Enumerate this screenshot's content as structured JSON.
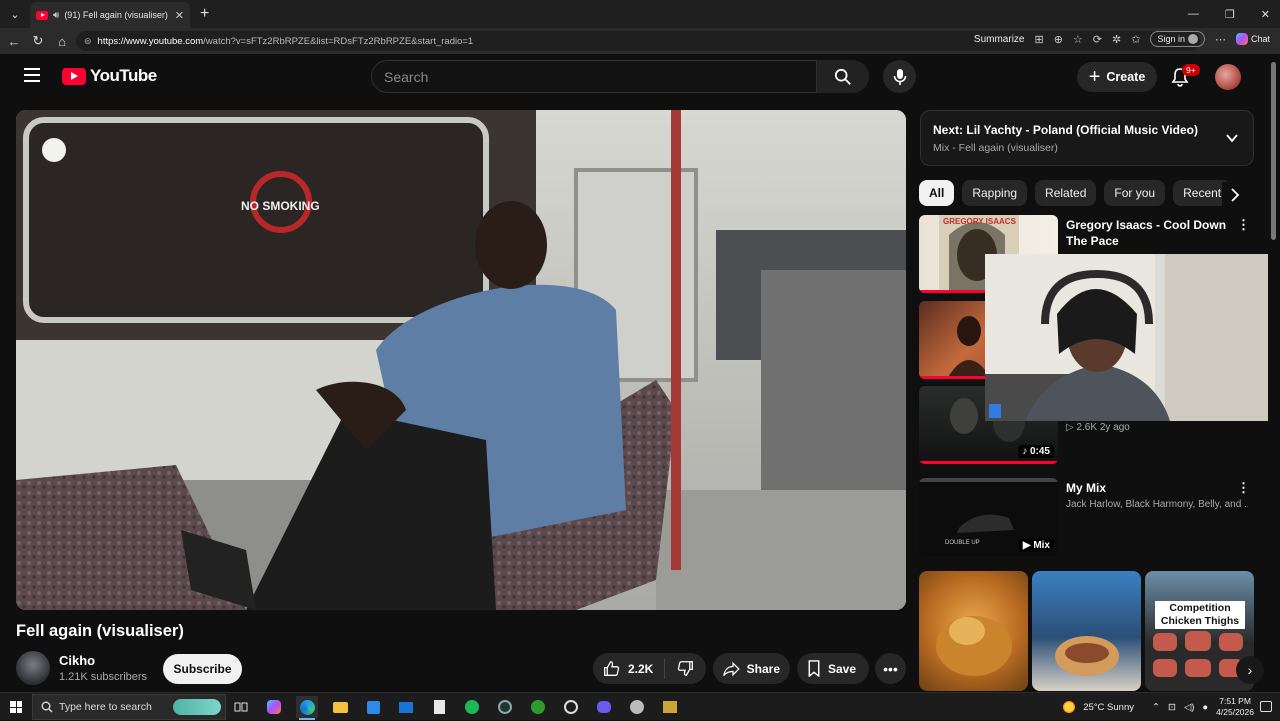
{
  "browser": {
    "tab_title": "(91) Fell again (visualiser) - Yo",
    "tab_close": "✕",
    "new_tab": "+",
    "url_host": "https://www.youtube.com",
    "url_path": "/watch?v=sFTz2RbRPZE&list=RDsFTz2RbRPZE&start_radio=1",
    "summarize": "Summarize",
    "sign_in": "Sign in",
    "chat": "Chat"
  },
  "header": {
    "logo_text": "YouTube",
    "search_placeholder": "Search",
    "create_label": "Create",
    "notification_count": "9+"
  },
  "video": {
    "overlay_sign": "NO SMOKING",
    "title": "Fell again (visualiser)",
    "channel_name": "Cikho",
    "subscribers": "1.21K subscribers",
    "subscribe_label": "Subscribe",
    "likes": "2.2K",
    "share_label": "Share",
    "save_label": "Save"
  },
  "up_next": {
    "prefix": "Next:",
    "title": "Lil Yachty - Poland (Official Music Video)",
    "mix": "Mix - Fell again (visualiser)"
  },
  "chips": [
    "All",
    "Rapping",
    "Related",
    "For you",
    "Recent"
  ],
  "recommendations": [
    {
      "title": "Gregory Isaacs - Cool Down The Pace",
      "thumb_text": "GREGORY ISAACS"
    },
    {
      "title": ""
    },
    {
      "meta": "▷ 2.6K   2y ago",
      "duration": "♪ 0:45"
    },
    {
      "title": "My Mix",
      "meta": "Jack Harlow, Black Harmony, Belly, and ...",
      "badge": "Mix",
      "thumb_text": "DOUBLE UP"
    }
  ],
  "shorts": [
    {
      "label": ""
    },
    {
      "label": ""
    },
    {
      "label": "Competition Chicken Thighs"
    }
  ],
  "taskbar": {
    "search_placeholder": "Type here to search",
    "weather": "25°C  Sunny",
    "time": "7:51 PM",
    "date": "4/25/2026"
  },
  "colors": {
    "accent": "#ff0033",
    "background": "#0f0f0f",
    "chip": "#272727"
  }
}
